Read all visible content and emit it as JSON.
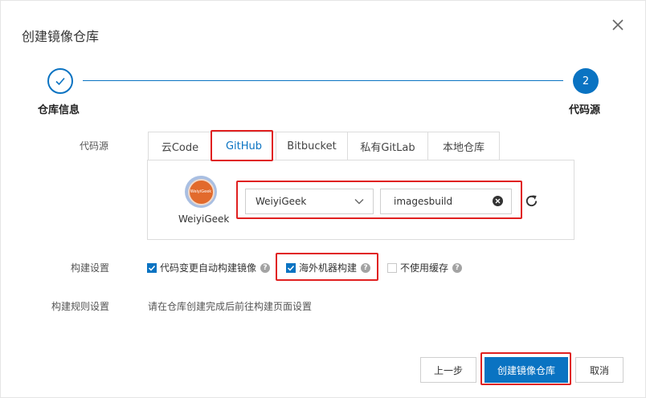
{
  "dialog": {
    "title": "创建镜像仓库"
  },
  "steps": [
    {
      "label": "仓库信息",
      "status": "done"
    },
    {
      "label": "代码源",
      "number": "2",
      "status": "active"
    }
  ],
  "code_source": {
    "label": "代码源",
    "tabs": [
      {
        "label": "云Code",
        "active": false
      },
      {
        "label": "GitHub",
        "active": true
      },
      {
        "label": "Bitbucket",
        "active": false
      },
      {
        "label": "私有GitLab",
        "active": false
      },
      {
        "label": "本地仓库",
        "active": false
      }
    ],
    "account": {
      "avatar_text": "WeiyiGeek",
      "name": "WeiyiGeek"
    },
    "namespace_select": {
      "value": "WeiyiGeek"
    },
    "repo_input": {
      "value": "imagesbuild"
    }
  },
  "build_settings": {
    "label": "构建设置",
    "options": [
      {
        "label": "代码变更自动构建镜像",
        "checked": true
      },
      {
        "label": "海外机器构建",
        "checked": true
      },
      {
        "label": "不使用缓存",
        "checked": false
      }
    ]
  },
  "build_rules": {
    "label": "构建规则设置",
    "hint": "请在仓库创建完成后前往构建页面设置"
  },
  "footer": {
    "prev_label": "上一步",
    "create_label": "创建镜像仓库",
    "cancel_label": "取消"
  },
  "colors": {
    "accent": "#0a73c2",
    "highlight": "#e02020"
  },
  "icons": [
    "close-icon",
    "check-icon",
    "chevron-down-icon",
    "clear-icon",
    "refresh-icon",
    "help-icon"
  ]
}
